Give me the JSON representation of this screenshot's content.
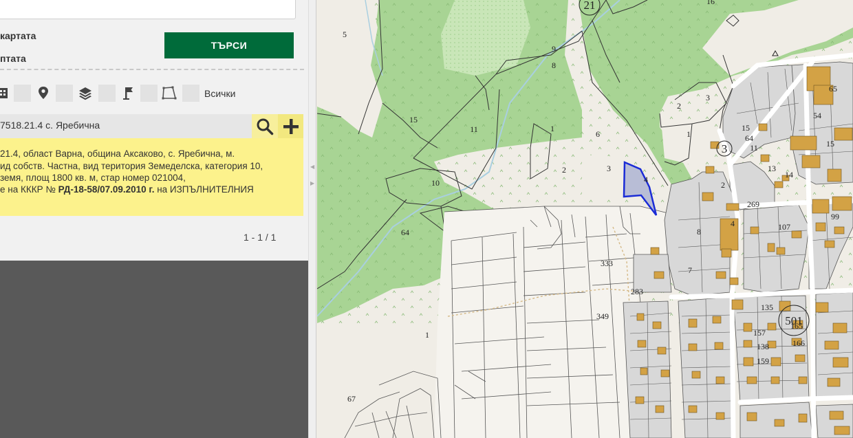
{
  "panel": {
    "option_map_label": "картата",
    "option_plot_label": "птата",
    "search_button_label": "ТЪРСИ",
    "layer_all_label": "Всички",
    "layer_icons": [
      "building-icon",
      "pin-icon",
      "layers-icon",
      "flag-icon",
      "polygon-icon"
    ],
    "result_title": "7518.21.4 с. Яребична",
    "result_lines": [
      "21.4, област Варна, община Аксаково, с. Яребична, м.",
      "ид собств. Частна, вид територия Земеделска, категория 10,",
      "земя, площ 1800 кв. м, стар номер 021004,"
    ],
    "result_order_prefix": "е на КККР № ",
    "result_order_number": "РД-18-58/07.09.2010 г.",
    "result_order_suffix": " на ИЗПЪЛНИТЕЛНИЯ",
    "pager": "1 - 1 / 1"
  },
  "map": {
    "forest_color": "#a8d494",
    "background_color": "#f0ede6",
    "block_fill_color": "#d8d8d8",
    "building_color": "#d3a245",
    "selected_parcel_color": "#1a2bd6",
    "water_color": "#a9cfe0",
    "parcel_labels": [
      {
        "text": "5"
      },
      {
        "text": "16"
      },
      {
        "text": "9"
      },
      {
        "text": "8"
      },
      {
        "text": "15"
      },
      {
        "text": "11"
      },
      {
        "text": "1"
      },
      {
        "text": "6"
      },
      {
        "text": "2"
      },
      {
        "text": "3"
      },
      {
        "text": "4"
      },
      {
        "text": "10"
      },
      {
        "text": "2"
      },
      {
        "text": "3"
      },
      {
        "text": "1"
      },
      {
        "text": "65"
      },
      {
        "text": "54"
      },
      {
        "text": "15"
      },
      {
        "text": "64"
      },
      {
        "text": "11"
      },
      {
        "text": "15"
      },
      {
        "text": "13"
      },
      {
        "text": "14"
      },
      {
        "text": "2"
      },
      {
        "text": "269"
      },
      {
        "text": "107"
      },
      {
        "text": "99"
      },
      {
        "text": "4"
      },
      {
        "text": "8"
      },
      {
        "text": "64"
      },
      {
        "text": "333"
      },
      {
        "text": "7"
      },
      {
        "text": "283"
      },
      {
        "text": "349"
      },
      {
        "text": "135"
      },
      {
        "text": "1"
      },
      {
        "text": "157"
      },
      {
        "text": "138"
      },
      {
        "text": "159"
      },
      {
        "text": "165"
      },
      {
        "text": "166"
      },
      {
        "text": "67"
      }
    ],
    "circle_labels": [
      {
        "text": "21"
      },
      {
        "text": "3"
      },
      {
        "text": "501"
      }
    ]
  }
}
